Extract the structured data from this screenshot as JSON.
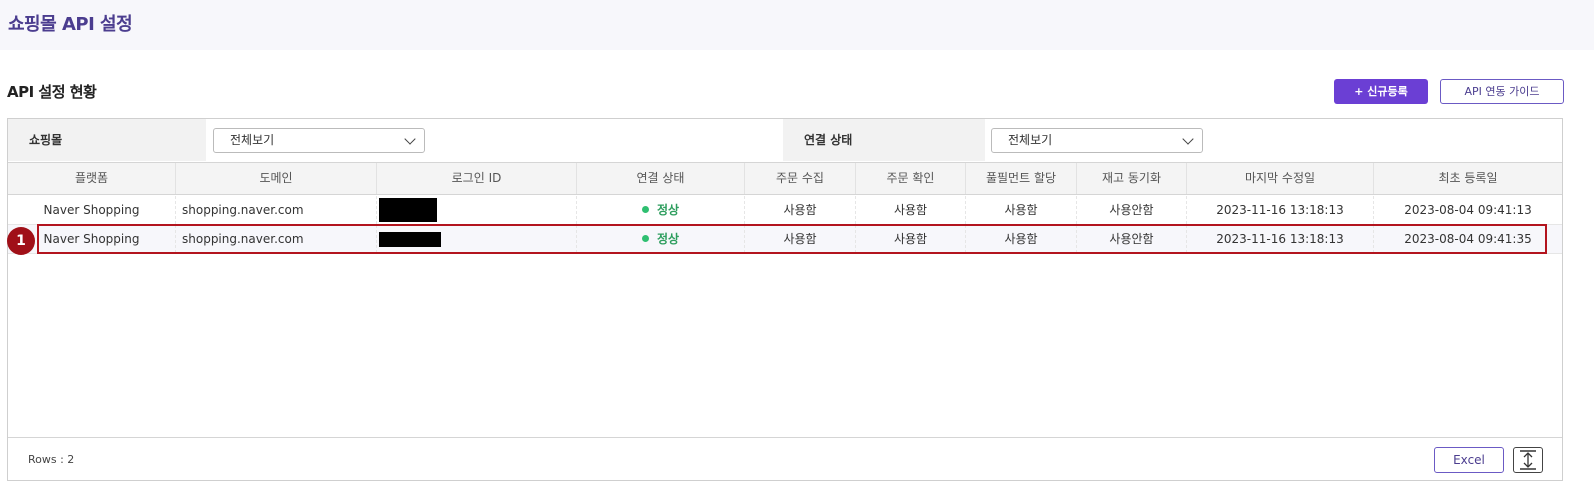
{
  "page": {
    "title": "쇼핑몰 API 설정"
  },
  "section": {
    "title": "API 설정 현황"
  },
  "actions": {
    "register_label": "+ 신규등록",
    "guide_label": "API 연동 가이드"
  },
  "filters": {
    "mall_label": "쇼핑몰",
    "mall_value": "전체보기",
    "status_label": "연결 상태",
    "status_value": "전체보기"
  },
  "table": {
    "columns": [
      "플랫폼",
      "도메인",
      "로그인 ID",
      "연결 상태",
      "주문 수집",
      "주문 확인",
      "풀필먼트 할당",
      "재고 동기화",
      "마지막 수정일",
      "최초 등록일"
    ],
    "rows": [
      {
        "platform": "Naver Shopping",
        "domain": "shopping.naver.com",
        "login_id": "",
        "status": "정상",
        "order_collect": "사용함",
        "order_confirm": "사용함",
        "fulfillment": "사용함",
        "stock_sync": "사용안함",
        "modified": "2023-11-16 13:18:13",
        "registered": "2023-08-04 09:41:13"
      },
      {
        "platform": "Naver Shopping",
        "domain": "shopping.naver.com",
        "login_id": "",
        "status": "정상",
        "order_collect": "사용함",
        "order_confirm": "사용함",
        "fulfillment": "사용함",
        "stock_sync": "사용안함",
        "modified": "2023-11-16 13:18:13",
        "registered": "2023-08-04 09:41:35"
      }
    ]
  },
  "annotation": {
    "marker": "1"
  },
  "footer": {
    "rows_label": "Rows : 2",
    "excel_label": "Excel"
  },
  "colors": {
    "accent": "#6b3fd4",
    "status_ok": "#2fbf71",
    "highlight": "#b3141e"
  }
}
